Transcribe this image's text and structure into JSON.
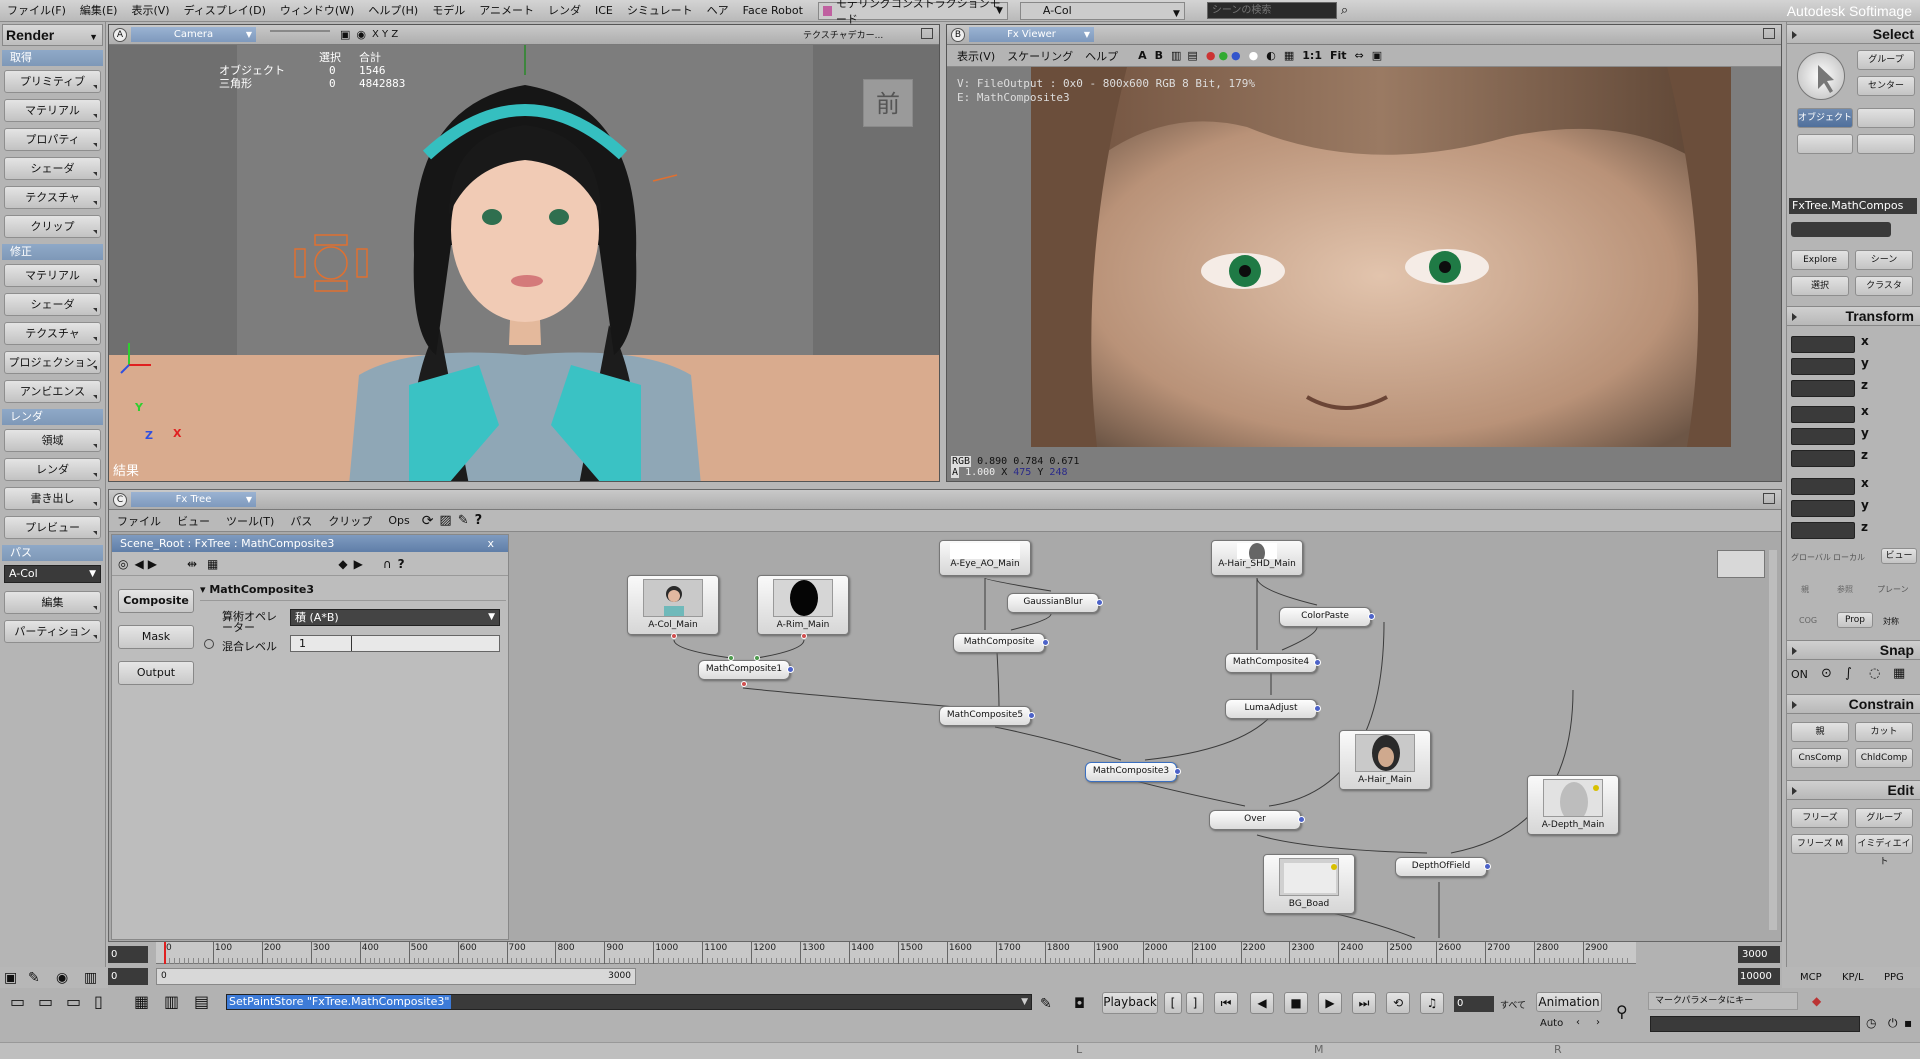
{
  "menubar": {
    "items": [
      "ファイル(F)",
      "編集(E)",
      "表示(V)",
      "ディスプレイ(D)",
      "ウィンドウ(W)",
      "ヘルプ(H)",
      "モデル",
      "アニメート",
      "レンダ",
      "ICE",
      "シミュレート",
      "ヘア",
      "Face Robot"
    ],
    "mode": "モデリングコンストラクションモード",
    "scene": "A-Col",
    "search_placeholder": "シーンの検索",
    "brand": "Autodesk Softimage"
  },
  "left": {
    "title": "Render",
    "sections": [
      {
        "header": "取得",
        "buttons": [
          "プリミティブ",
          "マテリアル",
          "プロパティ",
          "シェーダ",
          "テクスチャ",
          "クリップ"
        ]
      },
      {
        "header": "修正",
        "buttons": [
          "マテリアル",
          "シェーダ",
          "テクスチャ",
          "プロジェクション",
          "アンビエンス"
        ]
      },
      {
        "header": "レンダ",
        "buttons": [
          "領域",
          "レンダ",
          "書き出し",
          "プレビュー"
        ]
      },
      {
        "header": "パス",
        "select": "A-Col",
        "buttons": [
          "編集",
          "パーティション"
        ]
      }
    ]
  },
  "vpA": {
    "letter": "A",
    "camera": "Camera",
    "extra": "テクスチャデカー...",
    "axes": "X Y Z",
    "stats_headers": [
      "選択",
      "合計"
    ],
    "stats": [
      {
        "label": "オブジェクト",
        "sel": "0",
        "total": "1546"
      },
      {
        "label": "三角形",
        "sel": "0",
        "total": "4842883"
      }
    ],
    "front_label": "前",
    "result_label": "結果",
    "axis_y": "Y",
    "axis_z": "Z",
    "axis_x": "X"
  },
  "vpB": {
    "letter": "B",
    "camera": "Fx Viewer",
    "menu": [
      "表示(V)",
      "スケーリング",
      "ヘルプ"
    ],
    "tools": [
      "A",
      "B",
      "1:1",
      "Fit"
    ],
    "info_line1": "V: FileOutput : 0x0 - 800x600 RGB 8 Bit, 179%",
    "info_line2": "E: MathComposite3",
    "rgb_label": "RGB",
    "rgb_values": "0.890  0.784  0.671",
    "a_label": "A",
    "a_value": "1.000",
    "x_label": "X",
    "x_value": "475",
    "y_label": "Y",
    "y_value": "248"
  },
  "fxtree": {
    "letter": "C",
    "title": "Fx Tree",
    "menu": [
      "ファイル",
      "ビュー",
      "ツール(T)",
      "パス",
      "クリップ",
      "Ops"
    ],
    "panel_title": "Scene_Root : FxTree : MathComposite3",
    "close": "x",
    "tabs": [
      "Composite",
      "Mask",
      "Output"
    ],
    "node_title": "MathComposite3",
    "op_label": "算術オペレーター",
    "op_value": "積 (A*B)",
    "mix_label": "混合レベル",
    "mix_value": "1",
    "nodes": {
      "col": "A-Col_Main",
      "rim": "A-Rim_Main",
      "eye": "A-Eye_AO_Main",
      "hairshd": "A-Hair_SHD_Main",
      "gauss": "GaussianBlur",
      "colorpaste": "ColorPaste",
      "mc1": "MathComposite1",
      "mc": "MathComposite",
      "mc4": "MathComposite4",
      "mc5": "MathComposite5",
      "luma": "LumaAdjust",
      "mc3": "MathComposite3",
      "hair": "A-Hair_Main",
      "depth": "A-Depth_Main",
      "over": "Over",
      "dof": "DepthOfField",
      "bg": "BG_Boad"
    }
  },
  "right": {
    "select_hdr": "Select",
    "group": "グループ",
    "center": "センター",
    "object": "オブジェクト",
    "current": "FxTree.MathCompos",
    "explore": "Explore",
    "scene": "シーン",
    "sel": "選択",
    "cluster": "クラスタ",
    "transform_hdr": "Transform",
    "global": "グローバル",
    "local": "ローカル",
    "view": "ビュー",
    "par": "親",
    "ref": "参照",
    "plane": "プレーン",
    "cog": "COG",
    "prop": "Prop",
    "sym": "対称",
    "snap_hdr": "Snap",
    "snap_on": "ON",
    "constrain_hdr": "Constrain",
    "parent": "親",
    "cut": "カット",
    "cnscomp": "CnsComp",
    "chldcomp": "ChldComp",
    "edit_hdr": "Edit",
    "freeze": "フリーズ",
    "grp": "グループ",
    "freezem": "フリーズ M",
    "immed": "イミディエイト"
  },
  "timeline": {
    "ticks": [
      "0",
      "100",
      "200",
      "300",
      "400",
      "500",
      "600",
      "700",
      "800",
      "900",
      "1000",
      "1100",
      "1200",
      "1300",
      "1400",
      "1500",
      "1600",
      "1700",
      "1800",
      "1900",
      "2000",
      "2100",
      "2200",
      "2300",
      "2400",
      "2500",
      "2600",
      "2700",
      "2800",
      "2900"
    ],
    "start": "0",
    "end": "3000",
    "range_start": "0",
    "range_in": "0",
    "range_out": "3000",
    "range_end": "10000"
  },
  "bottom": {
    "command": "SetPaintStore \"FxTree.MathComposite3\"",
    "playback": "Playback",
    "frame": "0",
    "all": "すべて",
    "animation": "Animation",
    "auto": "Auto",
    "mcp": "MCP",
    "kpl": "KP/L",
    "ppg": "PPG",
    "markparam": "マークパラメータにキー",
    "status": [
      "L",
      "M",
      "R"
    ]
  }
}
